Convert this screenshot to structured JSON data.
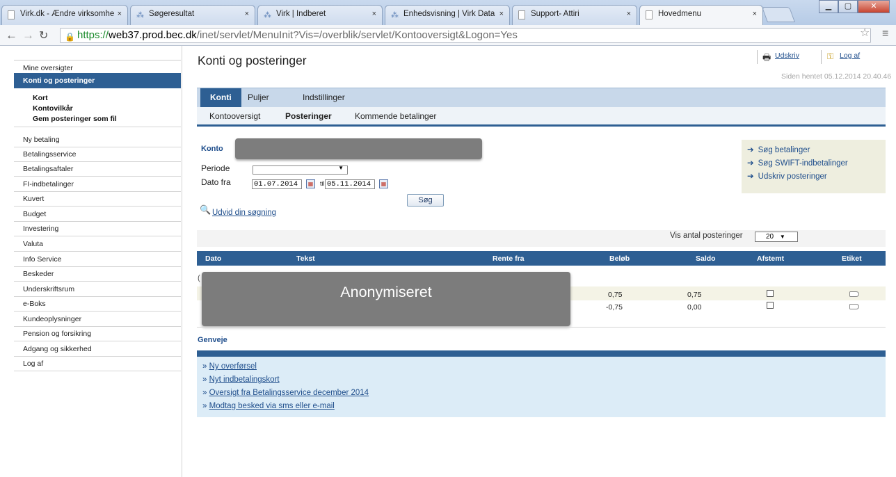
{
  "browser": {
    "tabs": [
      {
        "title": "Virk.dk - Ændre virksomhe",
        "icon": "page-icon"
      },
      {
        "title": "Søgeresultat",
        "icon": "virk-icon"
      },
      {
        "title": "Virk | Indberet",
        "icon": "virk-icon"
      },
      {
        "title": "Enhedsvisning | Virk Data",
        "icon": "virk-icon"
      },
      {
        "title": "Support- Attiri",
        "icon": "page-icon"
      },
      {
        "title": "Hovedmenu",
        "icon": "page-icon"
      }
    ],
    "close_glyph": "×",
    "url_protocol": "https://",
    "url_host": "web37.prod.bec.dk",
    "url_path": "/inet/servlet/MenuInit?Vis=/overblik/servlet/Kontooversigt&Logon=Yes"
  },
  "sidebar": {
    "items_top": [
      {
        "label": "Mine oversigter"
      },
      {
        "label": "Konti og posteringer",
        "active": true
      }
    ],
    "subitems": [
      "Kort",
      "Kontovilkår",
      "Gem posteringer som fil"
    ],
    "items": [
      "Ny betaling",
      "Betalingsservice",
      "Betalingsaftaler",
      "FI-indbetalinger",
      "Kuvert",
      "Budget",
      "Investering",
      "Valuta",
      "Info Service",
      "Beskeder",
      "Underskriftsrum",
      "e-Boks",
      "Kundeoplysninger",
      "Pension og forsikring",
      "Adgang og sikkerhed",
      "Log af"
    ]
  },
  "header": {
    "title": "Konti og posteringer",
    "print_label": "Udskriv",
    "logout_label": "Log af",
    "fetched": "Siden hentet 05.12.2014 20.40.46"
  },
  "tabs_primary": [
    "Konti",
    "Puljer",
    "Indstillinger"
  ],
  "tabs_secondary": [
    "Kontooversigt",
    "Posteringer",
    "Kommende betalinger"
  ],
  "form": {
    "konto_label": "Konto",
    "periode_label": "Periode",
    "periode_value": "",
    "dato_label": "Dato fra",
    "dato_fra": "01.07.2014",
    "til_label": "til",
    "dato_til": "05.11.2014",
    "search_button": "Søg",
    "expand_link": "Udvid din søgning"
  },
  "quick_links": [
    "Søg betalinger",
    "Søg SWIFT-indbetalinger",
    "Udskriv posteringer"
  ],
  "pagination": {
    "label": "Vis antal posteringer",
    "value": "20"
  },
  "table": {
    "columns": [
      "Dato",
      "Tekst",
      "Rente fra",
      "Beløb",
      "Saldo",
      "Afstemt",
      "Etiket"
    ],
    "rows": [
      {
        "belob": "0,75",
        "saldo": "0,75",
        "afstemt": false
      },
      {
        "belob": "-0,75",
        "saldo": "0,00",
        "afstemt": false
      }
    ],
    "anonymized_text": "Anonymiseret",
    "first_col_fragment": "("
  },
  "genveje": {
    "title": "Genveje",
    "links": [
      "Ny overførsel",
      "Nyt indbetalingskort",
      "Oversigt fra Betalingsservice december 2014",
      "Modtag besked via sms eller e-mail"
    ],
    "bullet": "»"
  },
  "colors": {
    "accent": "#2e5f93",
    "link": "#1f4e8c",
    "tab_bar": "#c8d8ea",
    "quick_box": "#eeeedf",
    "genveje_box": "#dcecf7",
    "anon_gray": "#7c7c7c"
  }
}
